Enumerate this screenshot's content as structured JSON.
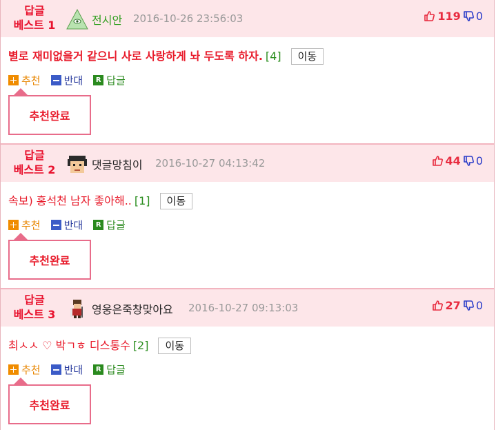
{
  "items": [
    {
      "rank_line1": "답글",
      "rank_line2": "베스트 1",
      "nickname": "전시안",
      "date": "2016-10-26 23:56:03",
      "up": "119",
      "down": "0",
      "title": "별로 재미없을거 같으니 사로 사랑하게 놔 두도록 하자.",
      "count": "[4]",
      "move_label": "이동",
      "recommend_label": "추천",
      "oppose_label": "반대",
      "reply_label": "답글",
      "reply_icon_letter": "R",
      "popup_text": "추천완료"
    },
    {
      "rank_line1": "답글",
      "rank_line2": "베스트 2",
      "nickname": "댓글망침이",
      "date": "2016-10-27 04:13:42",
      "up": "44",
      "down": "0",
      "title": "속보) 홍석천 남자 좋아해..",
      "count": "[1]",
      "move_label": "이동",
      "recommend_label": "추천",
      "oppose_label": "반대",
      "reply_label": "답글",
      "reply_icon_letter": "R",
      "popup_text": "추천완료"
    },
    {
      "rank_line1": "답글",
      "rank_line2": "베스트 3",
      "nickname": "영웅은죽창맞아요",
      "date": "2016-10-27 09:13:03",
      "up": "27",
      "down": "0",
      "title": "최ㅅㅅ ♡ 박ㄱㅎ 디스통수",
      "count": "[2]",
      "move_label": "이동",
      "recommend_label": "추천",
      "oppose_label": "반대",
      "reply_label": "답글",
      "reply_icon_letter": "R",
      "popup_text": "추천완료"
    }
  ],
  "colors": {
    "header_bg": "#fde6e9",
    "rank": "#e8112d",
    "up": "#e82b3f",
    "down": "#2a3cc9",
    "popup_border": "#e86c8a"
  }
}
